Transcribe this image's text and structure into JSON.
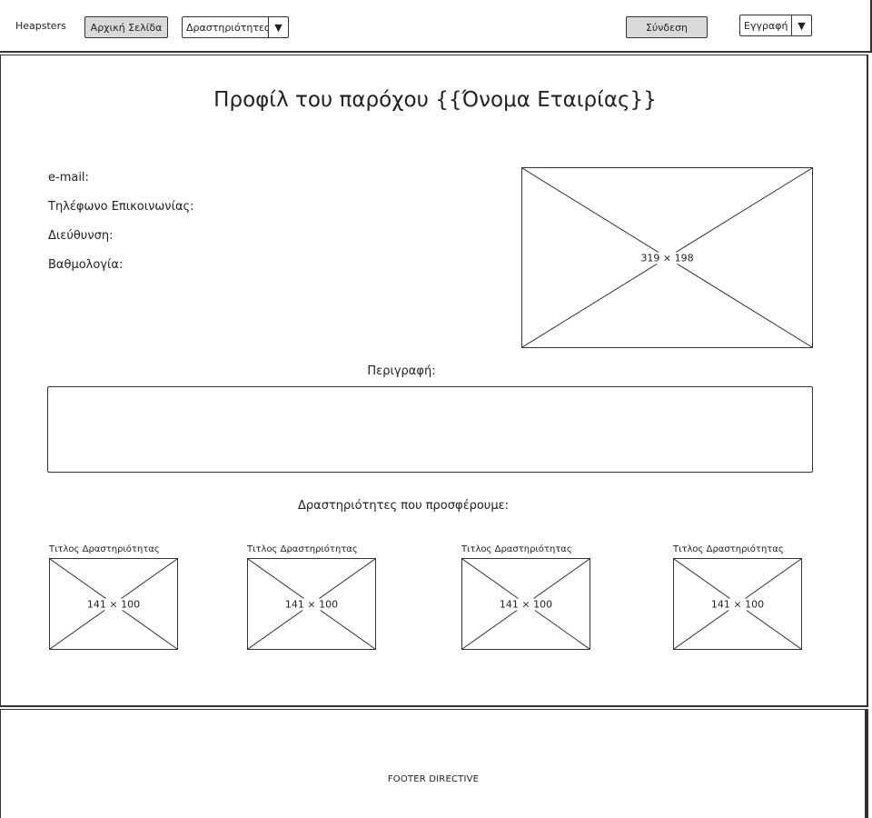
{
  "header": {
    "brand": "Heapsters",
    "home_label": "Αρχική Σελίδα",
    "activities_dropdown": "Δραστηριότητες",
    "login_label": "Σύνδεση",
    "register_dropdown": "Εγγραφή"
  },
  "profile": {
    "title": "Προφίλ του παρόχου {{Όνομα Εταιρίας}}",
    "email_label": "e-mail:",
    "phone_label": "Τηλέφωνο Επικοινωνίας:",
    "address_label": "Διεύθυνση:",
    "rating_label": "Βαθμολογία:",
    "image_size": "319 × 198"
  },
  "description": {
    "label": "Περιγραφή:"
  },
  "activities": {
    "heading": "Δραστηριότητες που προσφέρουμε:",
    "items": [
      {
        "title": "Τιτλος Δραστηριότητας",
        "image_size": "141 × 100"
      },
      {
        "title": "Τιτλος Δραστηριότητας",
        "image_size": "141 × 100"
      },
      {
        "title": "Τιτλος Δραστηριότητας",
        "image_size": "141 × 100"
      },
      {
        "title": "Τιτλος Δραστηριότητας",
        "image_size": "141 × 100"
      }
    ]
  },
  "footer": {
    "text": "FOOTER DIRECTIVE"
  },
  "icons": {
    "dropdown_arrow": "▼"
  }
}
